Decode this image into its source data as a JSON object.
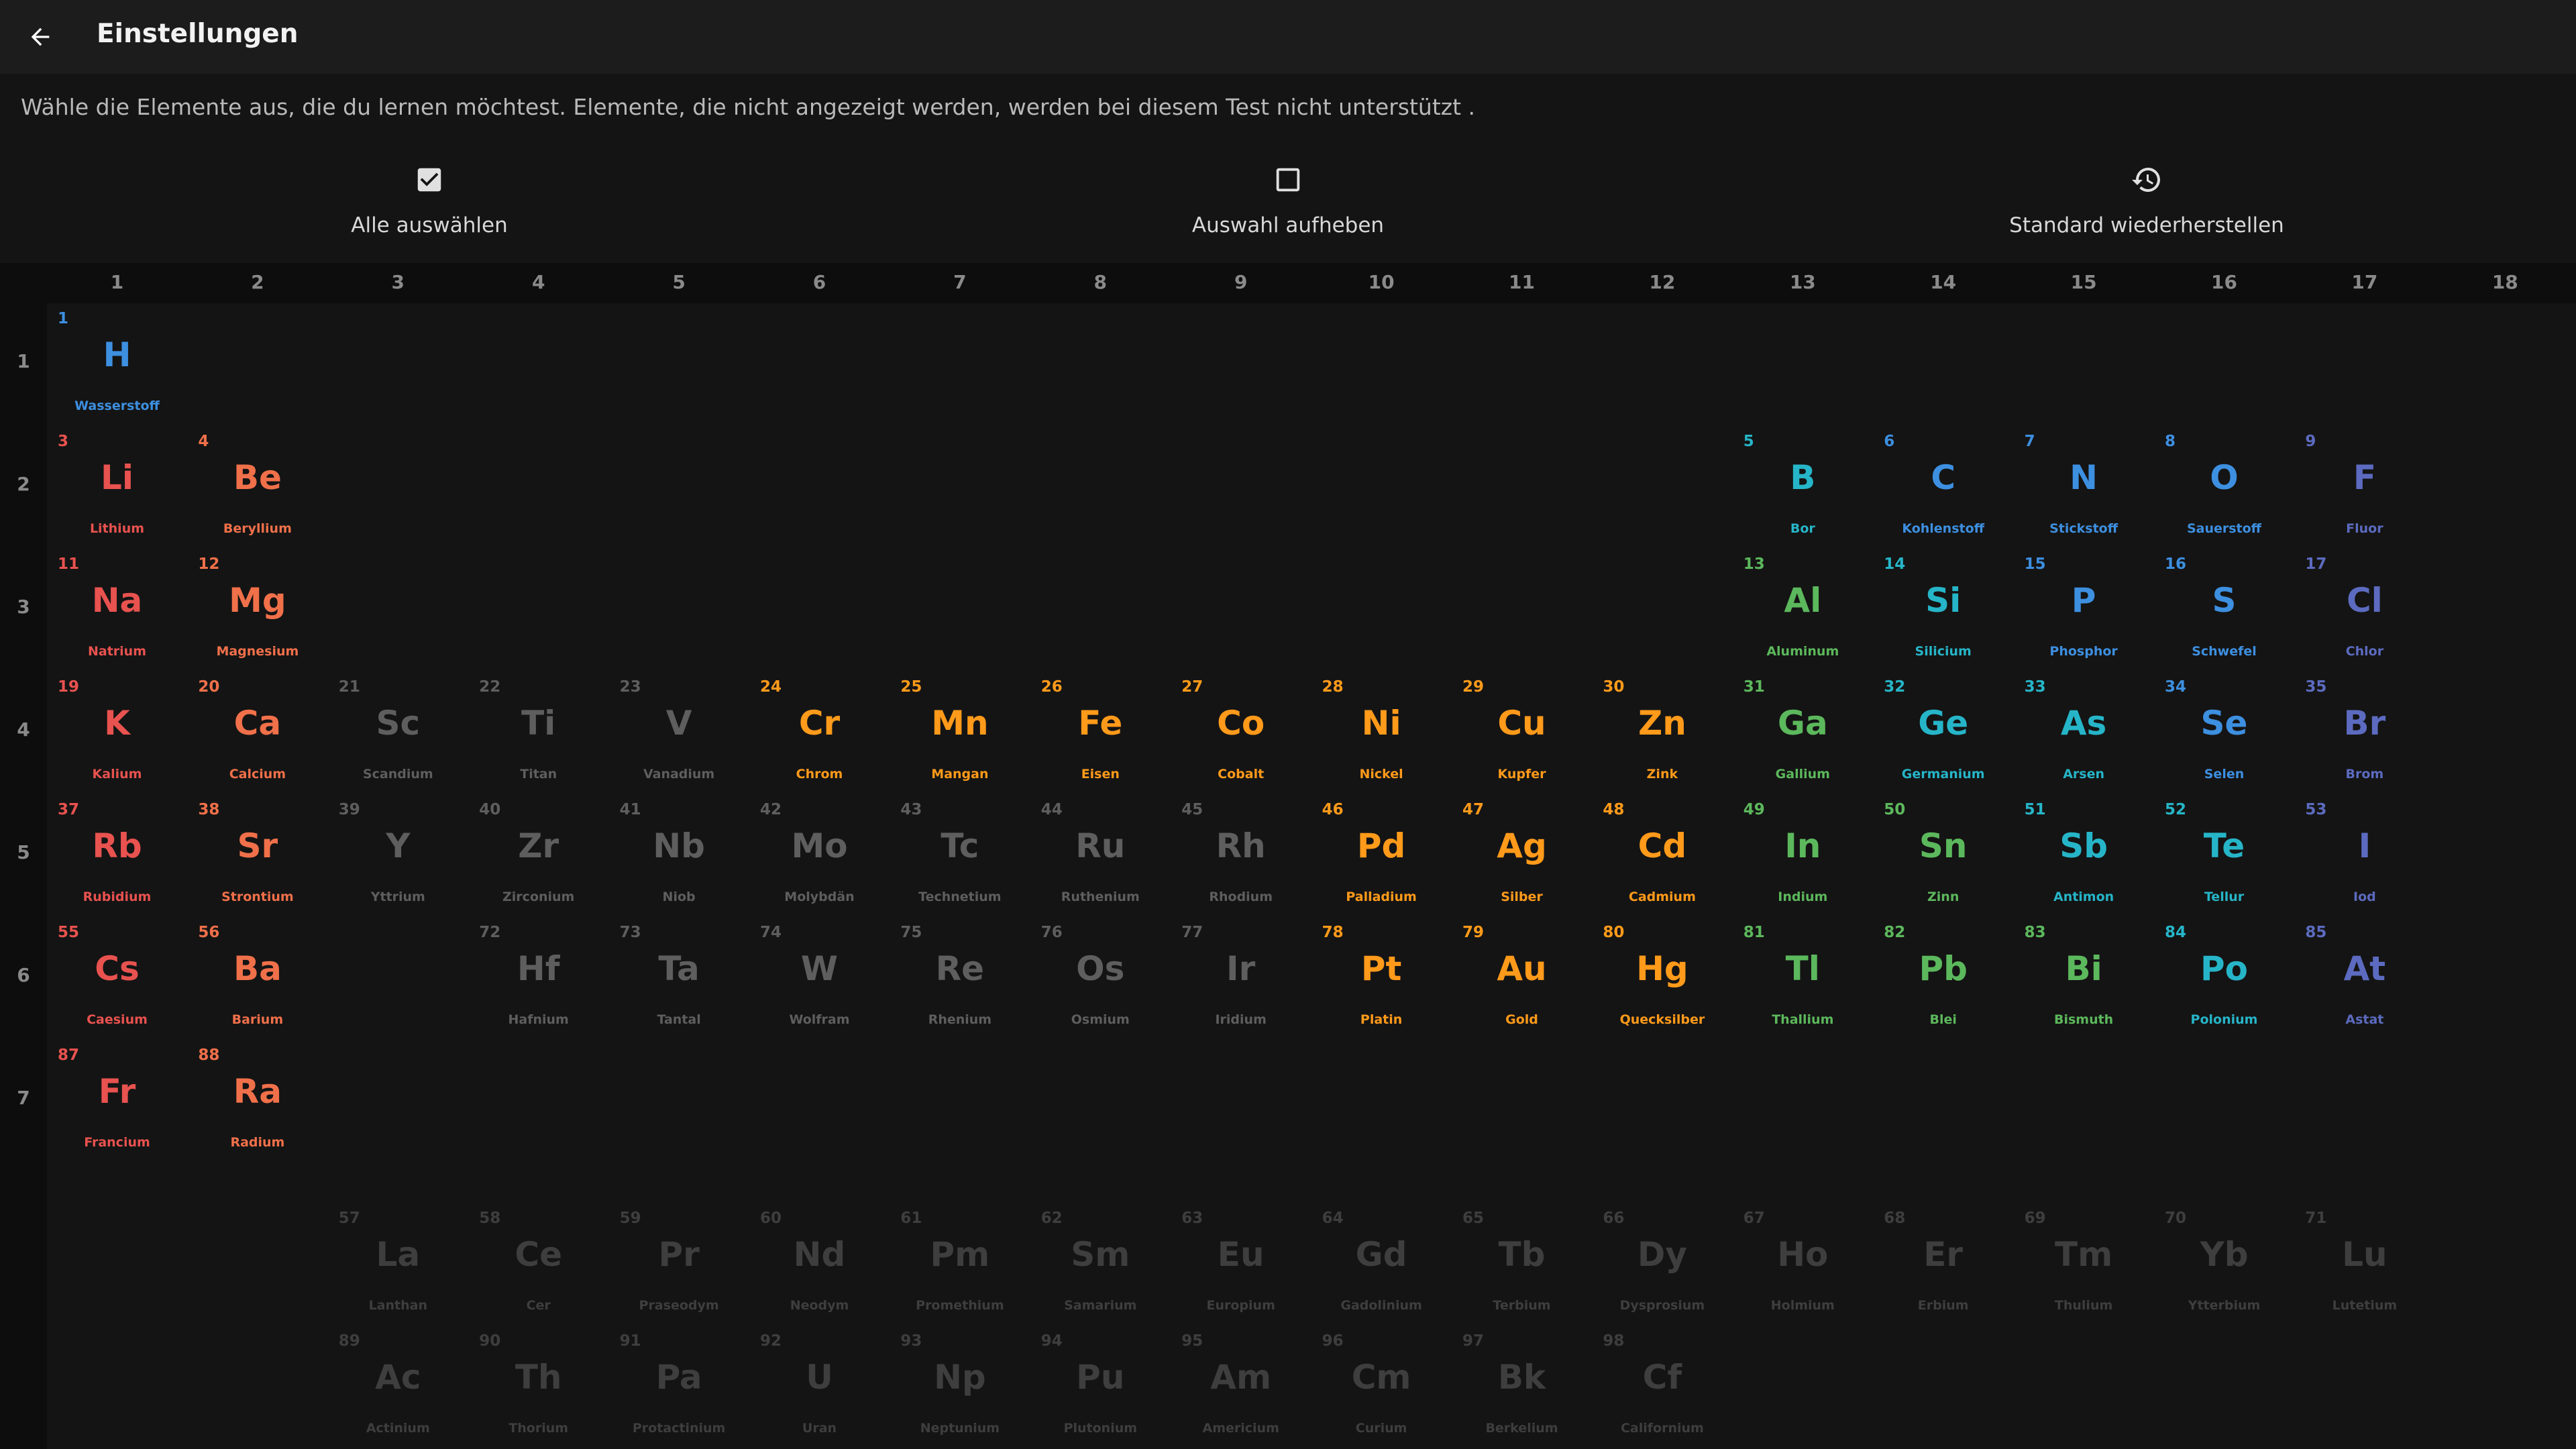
{
  "header": {
    "title": "Einstellungen"
  },
  "description": "Wähle die Elemente aus, die du lernen möchtest. Elemente, die nicht angezeigt werden, werden bei diesem Test nicht unterstützt .",
  "actions": [
    {
      "label": "Alle auswählen",
      "icon": "checkbox-checked-icon"
    },
    {
      "label": "Auswahl aufheben",
      "icon": "checkbox-empty-icon"
    },
    {
      "label": "Standard wiederherstellen",
      "icon": "history-icon"
    }
  ],
  "columns": [
    "1",
    "2",
    "3",
    "4",
    "5",
    "6",
    "7",
    "8",
    "9",
    "10",
    "11",
    "12",
    "13",
    "14",
    "15",
    "16",
    "17",
    "18"
  ],
  "rows": [
    "1",
    "2",
    "3",
    "4",
    "5",
    "6",
    "7"
  ],
  "colors": {
    "alkali": "#e8524f",
    "alkaline": "#f0704a",
    "transition": "#ff9a1a",
    "post": "#5cb85c",
    "metalloid": "#26b5c8",
    "nonmetal": "#3d8fe0",
    "halogen": "#5c6bc0",
    "inactive": "#5e5e5e",
    "faded": "#3e3e3e",
    "accent": "#ffffff"
  },
  "elements": [
    {
      "n": "1",
      "s": "H",
      "name": "Wasserstoff",
      "c": "nonmetal",
      "col": 1,
      "row": 1
    },
    {
      "n": "3",
      "s": "Li",
      "name": "Lithium",
      "c": "alkali",
      "col": 1,
      "row": 2
    },
    {
      "n": "4",
      "s": "Be",
      "name": "Beryllium",
      "c": "alkaline",
      "col": 2,
      "row": 2
    },
    {
      "n": "5",
      "s": "B",
      "name": "Bor",
      "c": "metalloid",
      "col": 13,
      "row": 2
    },
    {
      "n": "6",
      "s": "C",
      "name": "Kohlenstoff",
      "c": "nonmetal",
      "col": 14,
      "row": 2
    },
    {
      "n": "7",
      "s": "N",
      "name": "Stickstoff",
      "c": "nonmetal",
      "col": 15,
      "row": 2
    },
    {
      "n": "8",
      "s": "O",
      "name": "Sauerstoff",
      "c": "nonmetal",
      "col": 16,
      "row": 2
    },
    {
      "n": "9",
      "s": "F",
      "name": "Fluor",
      "c": "halogen",
      "col": 17,
      "row": 2
    },
    {
      "n": "11",
      "s": "Na",
      "name": "Natrium",
      "c": "alkali",
      "col": 1,
      "row": 3
    },
    {
      "n": "12",
      "s": "Mg",
      "name": "Magnesium",
      "c": "alkaline",
      "col": 2,
      "row": 3
    },
    {
      "n": "13",
      "s": "Al",
      "name": "Aluminum",
      "c": "post",
      "col": 13,
      "row": 3
    },
    {
      "n": "14",
      "s": "Si",
      "name": "Silicium",
      "c": "metalloid",
      "col": 14,
      "row": 3
    },
    {
      "n": "15",
      "s": "P",
      "name": "Phosphor",
      "c": "nonmetal",
      "col": 15,
      "row": 3
    },
    {
      "n": "16",
      "s": "S",
      "name": "Schwefel",
      "c": "nonmetal",
      "col": 16,
      "row": 3
    },
    {
      "n": "17",
      "s": "Cl",
      "name": "Chlor",
      "c": "halogen",
      "col": 17,
      "row": 3
    },
    {
      "n": "19",
      "s": "K",
      "name": "Kalium",
      "c": "alkali",
      "col": 1,
      "row": 4
    },
    {
      "n": "20",
      "s": "Ca",
      "name": "Calcium",
      "c": "alkaline",
      "col": 2,
      "row": 4
    },
    {
      "n": "21",
      "s": "Sc",
      "name": "Scandium",
      "c": "inactive",
      "col": 3,
      "row": 4
    },
    {
      "n": "22",
      "s": "Ti",
      "name": "Titan",
      "c": "inactive",
      "col": 4,
      "row": 4
    },
    {
      "n": "23",
      "s": "V",
      "name": "Vanadium",
      "c": "inactive",
      "col": 5,
      "row": 4
    },
    {
      "n": "24",
      "s": "Cr",
      "name": "Chrom",
      "c": "transition",
      "col": 6,
      "row": 4
    },
    {
      "n": "25",
      "s": "Mn",
      "name": "Mangan",
      "c": "transition",
      "col": 7,
      "row": 4
    },
    {
      "n": "26",
      "s": "Fe",
      "name": "Eisen",
      "c": "transition",
      "col": 8,
      "row": 4
    },
    {
      "n": "27",
      "s": "Co",
      "name": "Cobalt",
      "c": "transition",
      "col": 9,
      "row": 4
    },
    {
      "n": "28",
      "s": "Ni",
      "name": "Nickel",
      "c": "transition",
      "col": 10,
      "row": 4
    },
    {
      "n": "29",
      "s": "Cu",
      "name": "Kupfer",
      "c": "transition",
      "col": 11,
      "row": 4
    },
    {
      "n": "30",
      "s": "Zn",
      "name": "Zink",
      "c": "transition",
      "col": 12,
      "row": 4
    },
    {
      "n": "31",
      "s": "Ga",
      "name": "Gallium",
      "c": "post",
      "col": 13,
      "row": 4
    },
    {
      "n": "32",
      "s": "Ge",
      "name": "Germanium",
      "c": "metalloid",
      "col": 14,
      "row": 4
    },
    {
      "n": "33",
      "s": "As",
      "name": "Arsen",
      "c": "metalloid",
      "col": 15,
      "row": 4
    },
    {
      "n": "34",
      "s": "Se",
      "name": "Selen",
      "c": "nonmetal",
      "col": 16,
      "row": 4
    },
    {
      "n": "35",
      "s": "Br",
      "name": "Brom",
      "c": "halogen",
      "col": 17,
      "row": 4
    },
    {
      "n": "37",
      "s": "Rb",
      "name": "Rubidium",
      "c": "alkali",
      "col": 1,
      "row": 5
    },
    {
      "n": "38",
      "s": "Sr",
      "name": "Strontium",
      "c": "alkaline",
      "col": 2,
      "row": 5
    },
    {
      "n": "39",
      "s": "Y",
      "name": "Yttrium",
      "c": "inactive",
      "col": 3,
      "row": 5
    },
    {
      "n": "40",
      "s": "Zr",
      "name": "Zirconium",
      "c": "inactive",
      "col": 4,
      "row": 5
    },
    {
      "n": "41",
      "s": "Nb",
      "name": "Niob",
      "c": "inactive",
      "col": 5,
      "row": 5
    },
    {
      "n": "42",
      "s": "Mo",
      "name": "Molybdän",
      "c": "inactive",
      "col": 6,
      "row": 5
    },
    {
      "n": "43",
      "s": "Tc",
      "name": "Technetium",
      "c": "inactive",
      "col": 7,
      "row": 5
    },
    {
      "n": "44",
      "s": "Ru",
      "name": "Ruthenium",
      "c": "inactive",
      "col": 8,
      "row": 5
    },
    {
      "n": "45",
      "s": "Rh",
      "name": "Rhodium",
      "c": "inactive",
      "col": 9,
      "row": 5
    },
    {
      "n": "46",
      "s": "Pd",
      "name": "Palladium",
      "c": "transition",
      "col": 10,
      "row": 5
    },
    {
      "n": "47",
      "s": "Ag",
      "name": "Silber",
      "c": "transition",
      "col": 11,
      "row": 5
    },
    {
      "n": "48",
      "s": "Cd",
      "name": "Cadmium",
      "c": "transition",
      "col": 12,
      "row": 5
    },
    {
      "n": "49",
      "s": "In",
      "name": "Indium",
      "c": "post",
      "col": 13,
      "row": 5
    },
    {
      "n": "50",
      "s": "Sn",
      "name": "Zinn",
      "c": "post",
      "col": 14,
      "row": 5
    },
    {
      "n": "51",
      "s": "Sb",
      "name": "Antimon",
      "c": "metalloid",
      "col": 15,
      "row": 5
    },
    {
      "n": "52",
      "s": "Te",
      "name": "Tellur",
      "c": "metalloid",
      "col": 16,
      "row": 5
    },
    {
      "n": "53",
      "s": "I",
      "name": "Iod",
      "c": "halogen",
      "col": 17,
      "row": 5
    },
    {
      "n": "55",
      "s": "Cs",
      "name": "Caesium",
      "c": "alkali",
      "col": 1,
      "row": 6
    },
    {
      "n": "56",
      "s": "Ba",
      "name": "Barium",
      "c": "alkaline",
      "col": 2,
      "row": 6
    },
    {
      "n": "72",
      "s": "Hf",
      "name": "Hafnium",
      "c": "inactive",
      "col": 4,
      "row": 6
    },
    {
      "n": "73",
      "s": "Ta",
      "name": "Tantal",
      "c": "inactive",
      "col": 5,
      "row": 6
    },
    {
      "n": "74",
      "s": "W",
      "name": "Wolfram",
      "c": "inactive",
      "col": 6,
      "row": 6
    },
    {
      "n": "75",
      "s": "Re",
      "name": "Rhenium",
      "c": "inactive",
      "col": 7,
      "row": 6
    },
    {
      "n": "76",
      "s": "Os",
      "name": "Osmium",
      "c": "inactive",
      "col": 8,
      "row": 6
    },
    {
      "n": "77",
      "s": "Ir",
      "name": "Iridium",
      "c": "inactive",
      "col": 9,
      "row": 6
    },
    {
      "n": "78",
      "s": "Pt",
      "name": "Platin",
      "c": "transition",
      "col": 10,
      "row": 6
    },
    {
      "n": "79",
      "s": "Au",
      "name": "Gold",
      "c": "transition",
      "col": 11,
      "row": 6
    },
    {
      "n": "80",
      "s": "Hg",
      "name": "Quecksilber",
      "c": "transition",
      "col": 12,
      "row": 6
    },
    {
      "n": "81",
      "s": "Tl",
      "name": "Thallium",
      "c": "post",
      "col": 13,
      "row": 6
    },
    {
      "n": "82",
      "s": "Pb",
      "name": "Blei",
      "c": "post",
      "col": 14,
      "row": 6
    },
    {
      "n": "83",
      "s": "Bi",
      "name": "Bismuth",
      "c": "post",
      "col": 15,
      "row": 6
    },
    {
      "n": "84",
      "s": "Po",
      "name": "Polonium",
      "c": "metalloid",
      "col": 16,
      "row": 6
    },
    {
      "n": "85",
      "s": "At",
      "name": "Astat",
      "c": "halogen",
      "col": 17,
      "row": 6
    },
    {
      "n": "87",
      "s": "Fr",
      "name": "Francium",
      "c": "alkali",
      "col": 1,
      "row": 7
    },
    {
      "n": "88",
      "s": "Ra",
      "name": "Radium",
      "c": "alkaline",
      "col": 2,
      "row": 7
    },
    {
      "n": "57",
      "s": "La",
      "name": "Lanthan",
      "c": "faded",
      "col": 3,
      "row": 9
    },
    {
      "n": "58",
      "s": "Ce",
      "name": "Cer",
      "c": "faded",
      "col": 4,
      "row": 9
    },
    {
      "n": "59",
      "s": "Pr",
      "name": "Praseodym",
      "c": "faded",
      "col": 5,
      "row": 9
    },
    {
      "n": "60",
      "s": "Nd",
      "name": "Neodym",
      "c": "faded",
      "col": 6,
      "row": 9
    },
    {
      "n": "61",
      "s": "Pm",
      "name": "Promethium",
      "c": "faded",
      "col": 7,
      "row": 9
    },
    {
      "n": "62",
      "s": "Sm",
      "name": "Samarium",
      "c": "faded",
      "col": 8,
      "row": 9
    },
    {
      "n": "63",
      "s": "Eu",
      "name": "Europium",
      "c": "faded",
      "col": 9,
      "row": 9
    },
    {
      "n": "64",
      "s": "Gd",
      "name": "Gadolinium",
      "c": "faded",
      "col": 10,
      "row": 9
    },
    {
      "n": "65",
      "s": "Tb",
      "name": "Terbium",
      "c": "faded",
      "col": 11,
      "row": 9
    },
    {
      "n": "66",
      "s": "Dy",
      "name": "Dysprosium",
      "c": "faded",
      "col": 12,
      "row": 9
    },
    {
      "n": "67",
      "s": "Ho",
      "name": "Holmium",
      "c": "faded",
      "col": 13,
      "row": 9
    },
    {
      "n": "68",
      "s": "Er",
      "name": "Erbium",
      "c": "faded",
      "col": 14,
      "row": 9
    },
    {
      "n": "69",
      "s": "Tm",
      "name": "Thulium",
      "c": "faded",
      "col": 15,
      "row": 9
    },
    {
      "n": "70",
      "s": "Yb",
      "name": "Ytterbium",
      "c": "faded",
      "col": 16,
      "row": 9
    },
    {
      "n": "71",
      "s": "Lu",
      "name": "Lutetium",
      "c": "faded",
      "col": 17,
      "row": 9
    },
    {
      "n": "89",
      "s": "Ac",
      "name": "Actinium",
      "c": "faded",
      "col": 3,
      "row": 10
    },
    {
      "n": "90",
      "s": "Th",
      "name": "Thorium",
      "c": "faded",
      "col": 4,
      "row": 10
    },
    {
      "n": "91",
      "s": "Pa",
      "name": "Protactinium",
      "c": "faded",
      "col": 5,
      "row": 10
    },
    {
      "n": "92",
      "s": "U",
      "name": "Uran",
      "c": "faded",
      "col": 6,
      "row": 10
    },
    {
      "n": "93",
      "s": "Np",
      "name": "Neptunium",
      "c": "faded",
      "col": 7,
      "row": 10
    },
    {
      "n": "94",
      "s": "Pu",
      "name": "Plutonium",
      "c": "faded",
      "col": 8,
      "row": 10
    },
    {
      "n": "95",
      "s": "Am",
      "name": "Americium",
      "c": "faded",
      "col": 9,
      "row": 10
    },
    {
      "n": "96",
      "s": "Cm",
      "name": "Curium",
      "c": "faded",
      "col": 10,
      "row": 10
    },
    {
      "n": "97",
      "s": "Bk",
      "name": "Berkelium",
      "c": "faded",
      "col": 11,
      "row": 10
    },
    {
      "n": "98",
      "s": "Cf",
      "name": "Californium",
      "c": "faded",
      "col": 12,
      "row": 10
    }
  ]
}
